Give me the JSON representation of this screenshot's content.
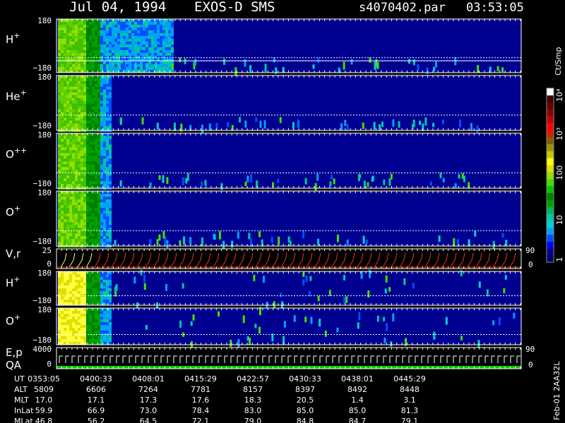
{
  "header": {
    "date": "Jul 04, 1994",
    "instrument": "EXOS-D SMS",
    "file": "s4070402.par",
    "time": "03:53:05"
  },
  "colorbar": {
    "unit": "Ct/Smp",
    "ticks": [
      "1",
      "10",
      "100",
      "10³",
      "10⁴"
    ],
    "colors": [
      "#000070",
      "#00008c",
      "#0000ff",
      "#0050ff",
      "#00a0ff",
      "#00d0d0",
      "#00c8a0",
      "#00b060",
      "#00a000",
      "#008000",
      "#00c800",
      "#40e000",
      "#90e000",
      "#e0e000",
      "#ffff00",
      "#c8c800",
      "#a09000",
      "#806000",
      "#d02000",
      "#ff0000",
      "#c00000",
      "#900000",
      "#600000",
      "#400000",
      "#ffffff"
    ]
  },
  "panels": [
    {
      "id": "h-plus-1",
      "label": "H",
      "sup": "+",
      "ymax": "180",
      "ymin": "−180"
    },
    {
      "id": "he-plus",
      "label": "He",
      "sup": "+",
      "ymax": "180",
      "ymin": "−180"
    },
    {
      "id": "o-plusplus",
      "label": "O",
      "sup": "++",
      "ymax": "180",
      "ymin": "−180"
    },
    {
      "id": "o-plus-1",
      "label": "O",
      "sup": "+",
      "ymax": "180",
      "ymin": "−180"
    },
    {
      "id": "vr",
      "label": "V,r",
      "sup": "",
      "ymax": "25",
      "ymin": "0",
      "right_top": "90",
      "right_bot": "0"
    },
    {
      "id": "h-plus-2",
      "label": "H",
      "sup": "+",
      "ymax": "180",
      "ymin": "−180"
    },
    {
      "id": "o-plus-2",
      "label": "O",
      "sup": "+",
      "ymax": "180",
      "ymin": "−180"
    },
    {
      "id": "ep",
      "label": "E,p",
      "sup": "",
      "label2": "QA",
      "ymax": "4000",
      "ymin": "0",
      "right_top": "90",
      "right_bot": "0"
    }
  ],
  "footer_note": "Feb-01 2AA32L",
  "chart_data": {
    "type": "heatmap",
    "title": "Jul 04, 1994   EXOS-D SMS",
    "x_axis": "UT",
    "ephemeris": {
      "rows": [
        {
          "name": "UT",
          "values": [
            "0353:05",
            "0400:33",
            "0408:01",
            "0415:29",
            "0422:57",
            "0430:33",
            "0438:01",
            "0445:29"
          ]
        },
        {
          "name": "ALT",
          "values": [
            "5809",
            "6606",
            "7264",
            "7781",
            "8157",
            "8397",
            "8492",
            "8448"
          ]
        },
        {
          "name": "MLT",
          "values": [
            "17.0",
            "17.1",
            "17.3",
            "17.6",
            "18.3",
            "20.5",
            "1.4",
            "3.1"
          ]
        },
        {
          "name": "InLat",
          "values": [
            "59.9",
            "66.9",
            "73.0",
            "78.4",
            "83.0",
            "85.0",
            "85.0",
            "81.3"
          ]
        },
        {
          "name": "MLat",
          "values": [
            "46.8",
            "56.2",
            "64.5",
            "72.1",
            "79.0",
            "84.8",
            "84.7",
            "79.1"
          ]
        }
      ]
    },
    "colorbar_range": [
      1,
      10000
    ],
    "colorbar_scale": "log"
  }
}
